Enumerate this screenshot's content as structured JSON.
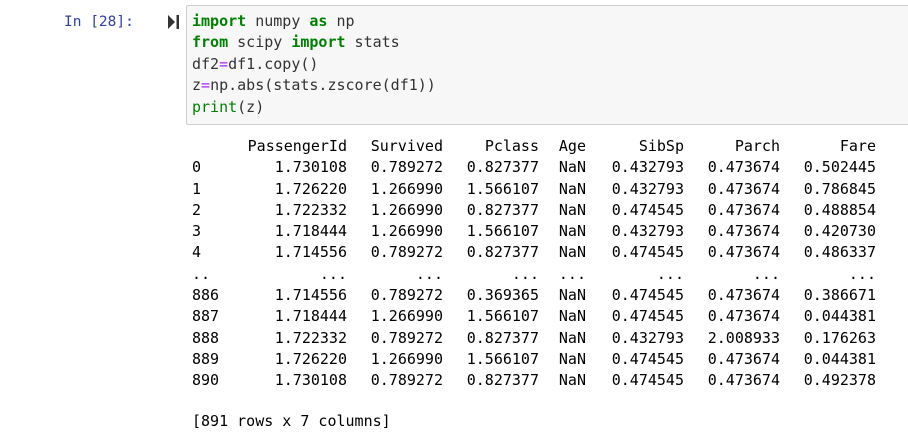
{
  "cell": {
    "prompt": "In [28]:",
    "run_icon": "run-cell-icon",
    "code_lines": [
      [
        {
          "t": "import",
          "c": "kw"
        },
        {
          "t": " numpy ",
          "c": ""
        },
        {
          "t": "as",
          "c": "kw"
        },
        {
          "t": " np",
          "c": ""
        }
      ],
      [
        {
          "t": "from",
          "c": "kw"
        },
        {
          "t": " scipy ",
          "c": ""
        },
        {
          "t": "import",
          "c": "kw"
        },
        {
          "t": " stats",
          "c": ""
        }
      ],
      [
        {
          "t": "df2",
          "c": ""
        },
        {
          "t": "=",
          "c": "op"
        },
        {
          "t": "df1.copy()",
          "c": ""
        }
      ],
      [
        {
          "t": "z",
          "c": ""
        },
        {
          "t": "=",
          "c": "op"
        },
        {
          "t": "np.abs(stats.zscore(df1))",
          "c": ""
        }
      ],
      [
        {
          "t": "print",
          "c": "bi"
        },
        {
          "t": "(z)",
          "c": ""
        }
      ]
    ]
  },
  "output": {
    "columns": [
      "PassengerId",
      "Survived",
      "Pclass",
      "Age",
      "SibSp",
      "Parch",
      "Fare"
    ],
    "rows": [
      {
        "index": "0",
        "values": [
          "1.730108",
          "0.789272",
          "0.827377",
          "NaN",
          "0.432793",
          "0.473674",
          "0.502445"
        ]
      },
      {
        "index": "1",
        "values": [
          "1.726220",
          "1.266990",
          "1.566107",
          "NaN",
          "0.432793",
          "0.473674",
          "0.786845"
        ]
      },
      {
        "index": "2",
        "values": [
          "1.722332",
          "1.266990",
          "0.827377",
          "NaN",
          "0.474545",
          "0.473674",
          "0.488854"
        ]
      },
      {
        "index": "3",
        "values": [
          "1.718444",
          "1.266990",
          "1.566107",
          "NaN",
          "0.432793",
          "0.473674",
          "0.420730"
        ]
      },
      {
        "index": "4",
        "values": [
          "1.714556",
          "0.789272",
          "0.827377",
          "NaN",
          "0.474545",
          "0.473674",
          "0.486337"
        ]
      },
      {
        "index": "..",
        "values": [
          "...",
          "...",
          "...",
          "...",
          "...",
          "...",
          "..."
        ]
      },
      {
        "index": "886",
        "values": [
          "1.714556",
          "0.789272",
          "0.369365",
          "NaN",
          "0.474545",
          "0.473674",
          "0.386671"
        ]
      },
      {
        "index": "887",
        "values": [
          "1.718444",
          "1.266990",
          "1.566107",
          "NaN",
          "0.474545",
          "0.473674",
          "0.044381"
        ]
      },
      {
        "index": "888",
        "values": [
          "1.722332",
          "0.789272",
          "0.827377",
          "NaN",
          "0.432793",
          "2.008933",
          "0.176263"
        ]
      },
      {
        "index": "889",
        "values": [
          "1.726220",
          "1.266990",
          "1.566107",
          "NaN",
          "0.474545",
          "0.473674",
          "0.044381"
        ]
      },
      {
        "index": "890",
        "values": [
          "1.730108",
          "0.789272",
          "0.827377",
          "NaN",
          "0.474545",
          "0.473674",
          "0.492378"
        ]
      }
    ],
    "summary": "[891 rows x 7 columns]"
  },
  "colors": {
    "prompt": "#303f9f",
    "keyword": "#008000",
    "operator": "#aa22ff",
    "input_bg": "#f7f7f7"
  }
}
